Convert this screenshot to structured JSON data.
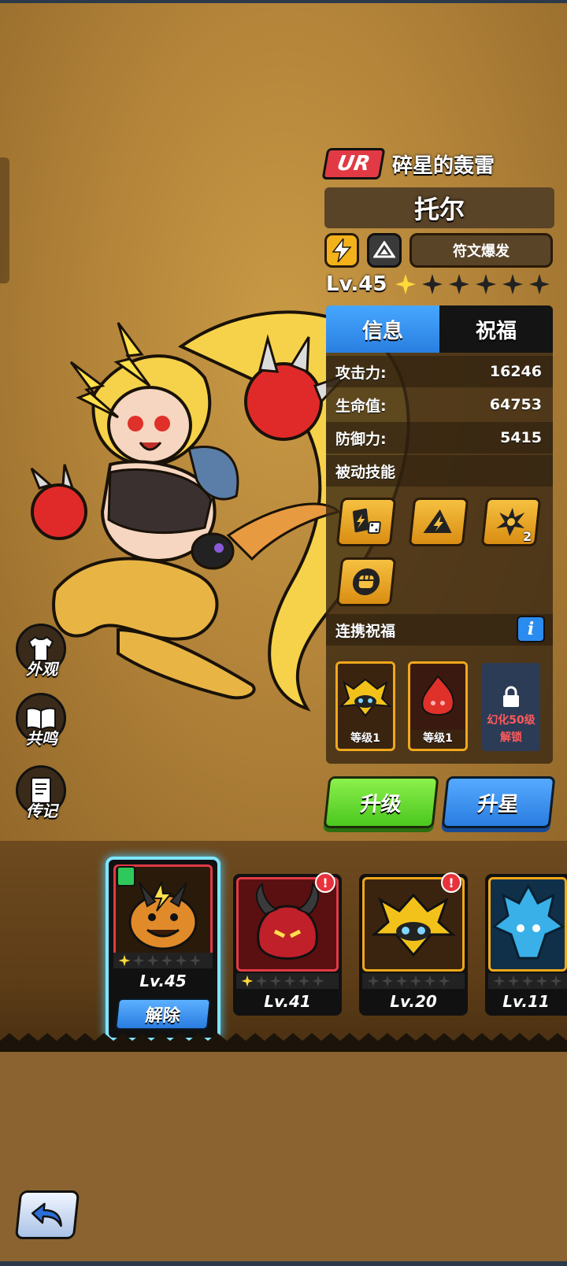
{
  "hero": {
    "rarity": "UR",
    "title": "碎星的轰雷",
    "name": "托尔",
    "skill_name": "符文爆发",
    "level": "Lv.45",
    "stars_filled": 1,
    "stars_total": 6,
    "element_icon": "lightning-icon",
    "class_icon": "triangle-class-icon"
  },
  "tabs": [
    {
      "label": "信息",
      "active": true
    },
    {
      "label": "祝福",
      "active": false
    }
  ],
  "stats": [
    {
      "label": "攻击力:",
      "value": "16246"
    },
    {
      "label": "生命值:",
      "value": "64753"
    },
    {
      "label": "防御力:",
      "value": "5415"
    }
  ],
  "passive": {
    "label": "被动技能",
    "skills": [
      {
        "icon": "cards-dice-icon",
        "count": ""
      },
      {
        "icon": "lightning-triangle-icon",
        "count": ""
      },
      {
        "icon": "burst-star-icon",
        "count": "2"
      },
      {
        "icon": "fist-icon",
        "count": ""
      }
    ]
  },
  "blessing": {
    "label": "连携祝福",
    "info": "i",
    "cards": [
      {
        "level": "等级1",
        "color": "#f3c21a"
      },
      {
        "level": "等级1",
        "color": "#e0302a"
      }
    ],
    "locked_line1": "幻化50级",
    "locked_line2": "解锁"
  },
  "actions": {
    "upgrade": "升级",
    "star_up": "升星"
  },
  "side_menu": [
    {
      "label": "外观",
      "icon": "shirt-icon"
    },
    {
      "label": "共鸣",
      "icon": "book-icon"
    },
    {
      "label": "传记",
      "icon": "journal-icon"
    }
  ],
  "bottom_cards": [
    {
      "level": "Lv.45",
      "stars": 1,
      "selected": true,
      "button": "解除",
      "alert": false
    },
    {
      "level": "Lv.41",
      "stars": 1,
      "selected": false,
      "alert": true
    },
    {
      "level": "Lv.20",
      "stars": 0,
      "selected": false,
      "alert": true
    },
    {
      "level": "Lv.11",
      "stars": 0,
      "selected": false,
      "alert": false
    }
  ],
  "colors": {
    "accent_blue": "#2a7de0",
    "accent_green": "#4bc71e",
    "rarity_red": "#e23a45",
    "gold": "#f3b21a"
  }
}
